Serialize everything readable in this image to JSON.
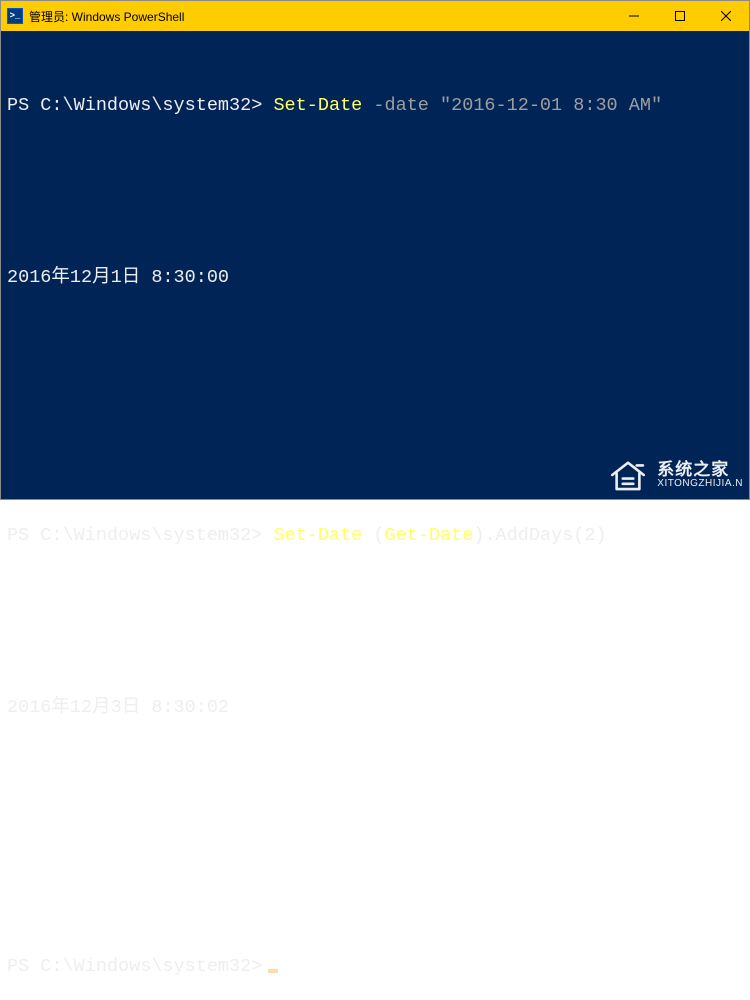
{
  "window": {
    "title": "管理员: Windows PowerShell",
    "icon_text": ">_"
  },
  "terminal": {
    "prompt": "PS C:\\Windows\\system32>",
    "lines": [
      {
        "type": "cmd1",
        "cmdlet": "Set-Date",
        "param": "-date",
        "string": "\"2016-12-01 8:30 AM\""
      },
      {
        "type": "blank"
      },
      {
        "type": "output",
        "text": "2016年12月1日 8:30:00"
      },
      {
        "type": "blank"
      },
      {
        "type": "blank"
      },
      {
        "type": "cmd2",
        "cmdlet": "Set-Date",
        "open": "(",
        "inner": "Get-Date",
        "close": ").AddDays(2)"
      },
      {
        "type": "blank"
      },
      {
        "type": "output",
        "text": "2016年12月3日 8:30:02"
      },
      {
        "type": "blank"
      },
      {
        "type": "blank"
      },
      {
        "type": "prompt-cursor"
      }
    ]
  },
  "watermark": {
    "main": "系统之家",
    "sub": "XITONGZHIJIA.N"
  }
}
